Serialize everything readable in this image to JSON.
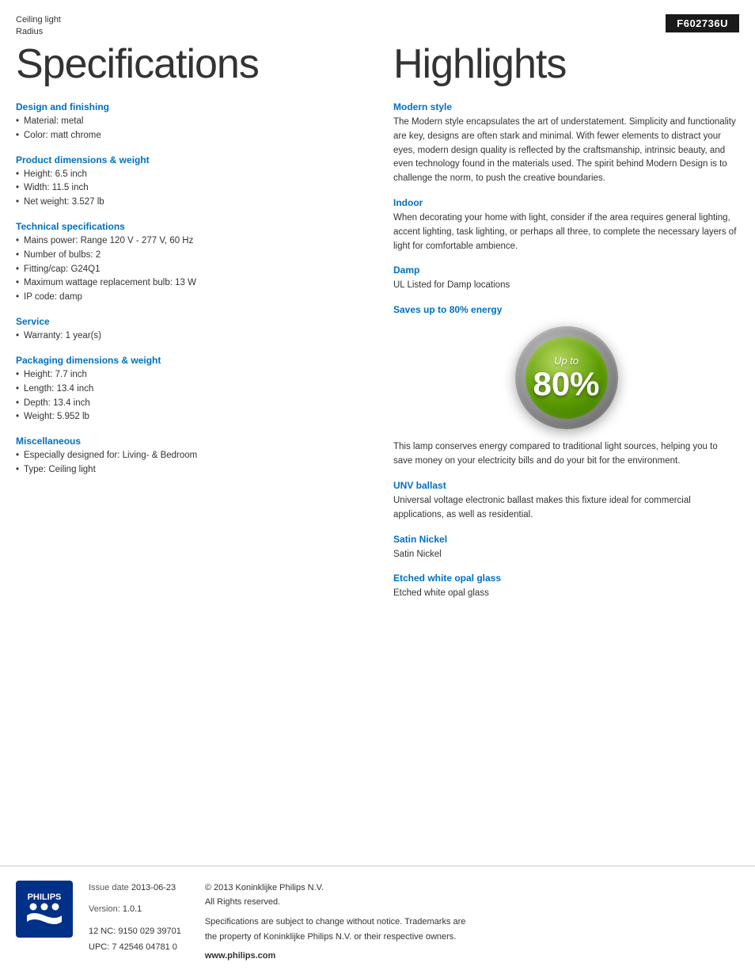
{
  "product": {
    "category": "Ceiling light",
    "subcategory": "Radius",
    "model": "F602736U"
  },
  "specs_title": "Specifications",
  "highlights_title": "Highlights",
  "sections": {
    "design": {
      "title": "Design and finishing",
      "items": [
        "Material: metal",
        "Color: matt chrome"
      ]
    },
    "product_dimensions": {
      "title": "Product dimensions & weight",
      "items": [
        "Height: 6.5 inch",
        "Width: 11.5 inch",
        "Net weight: 3.527 lb"
      ]
    },
    "technical": {
      "title": "Technical specifications",
      "items": [
        "Mains power: Range 120 V - 277 V, 60 Hz",
        "Number of bulbs: 2",
        "Fitting/cap: G24Q1",
        "Maximum wattage replacement bulb: 13 W",
        "IP code: damp"
      ]
    },
    "service": {
      "title": "Service",
      "items": [
        "Warranty: 1 year(s)"
      ]
    },
    "packaging": {
      "title": "Packaging dimensions & weight",
      "items": [
        "Height: 7.7 inch",
        "Length: 13.4 inch",
        "Depth: 13.4 inch",
        "Weight: 5.952 lb"
      ]
    },
    "miscellaneous": {
      "title": "Miscellaneous",
      "items": [
        "Especially designed for: Living- & Bedroom",
        "Type: Ceiling light"
      ]
    }
  },
  "highlights": {
    "modern_style": {
      "title": "Modern style",
      "text": "The Modern style encapsulates the art of understatement. Simplicity and functionality are key, designs are often stark and minimal. With fewer elements to distract your eyes, modern design quality is reflected by the craftsmanship, intrinsic beauty, and even technology found in the materials used. The spirit behind Modern Design is to challenge the norm, to push the creative boundaries."
    },
    "indoor": {
      "title": "Indoor",
      "text": "When decorating your home with light, consider if the area requires general lighting, accent lighting, task lighting, or perhaps all three, to complete the necessary layers of light for comfortable ambience."
    },
    "damp": {
      "title": "Damp",
      "text": "UL Listed for Damp locations"
    },
    "saves_energy": {
      "title": "Saves up to 80% energy",
      "badge_upto": "Up to",
      "badge_percent": "80%"
    },
    "energy_text": "This lamp conserves energy compared to traditional light sources, helping you to save money on your electricity bills and do your bit for the environment.",
    "unv_ballast": {
      "title": "UNV ballast",
      "text": "Universal voltage electronic ballast makes this fixture ideal for commercial applications, as well as residential."
    },
    "satin_nickel": {
      "title": "Satin Nickel",
      "text": "Satin Nickel"
    },
    "etched_glass": {
      "title": "Etched white opal glass",
      "text": "Etched white opal glass"
    }
  },
  "footer": {
    "issue_label": "Issue date",
    "issue_date": "2013-06-23",
    "version_label": "Version:",
    "version": "1.0.1",
    "nc_label": "12 NC:",
    "nc_value": "9150 029 39701",
    "upc_label": "UPC:",
    "upc_value": "7 42546 04781 0",
    "copyright": "© 2013 Koninklijke Philips N.V.",
    "rights": "All Rights reserved.",
    "disclaimer": "Specifications are subject to change without notice. Trademarks are the property of Koninklijke Philips N.V. or their respective owners.",
    "website": "www.philips.com"
  }
}
